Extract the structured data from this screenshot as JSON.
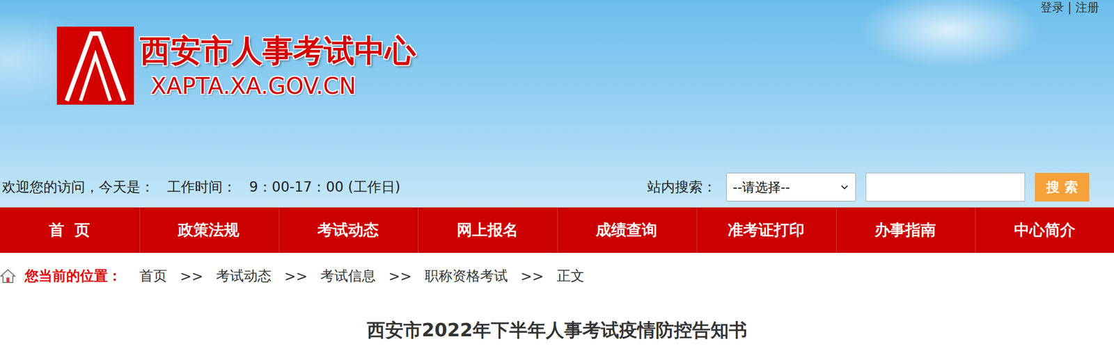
{
  "header": {
    "top_links": "登录 | 注册",
    "logo": {
      "title": "西安市人事考试中心",
      "domain": "XAPTA.XA.GOV.CN"
    }
  },
  "info_bar": {
    "welcome": "欢迎您的访问，今天是：",
    "hours_label": "工作时间：",
    "hours": "9：00-17：00 (工作日)"
  },
  "search": {
    "label": "站内搜索：",
    "select": "--请选择--",
    "button": "搜 索"
  },
  "nav": [
    {
      "label": "首  页",
      "selected": false
    },
    {
      "label": "政策法规",
      "selected": false
    },
    {
      "label": "考试动态",
      "selected": false
    },
    {
      "label": "网上报名",
      "selected": false
    },
    {
      "label": "成绩查询",
      "selected": false
    },
    {
      "label": "准考证打印",
      "selected": false
    },
    {
      "label": "办事指南",
      "selected": false
    },
    {
      "label": "中心简介",
      "selected": false
    }
  ],
  "breadcrumb": {
    "label": "您当前的位置：",
    "separator": ">>",
    "items": [
      "首页",
      "考试动态",
      "考试信息",
      "职称资格考试",
      "正文"
    ]
  },
  "article": {
    "title": "西安市2022年下半年人事考试疫情防控告知书"
  }
}
